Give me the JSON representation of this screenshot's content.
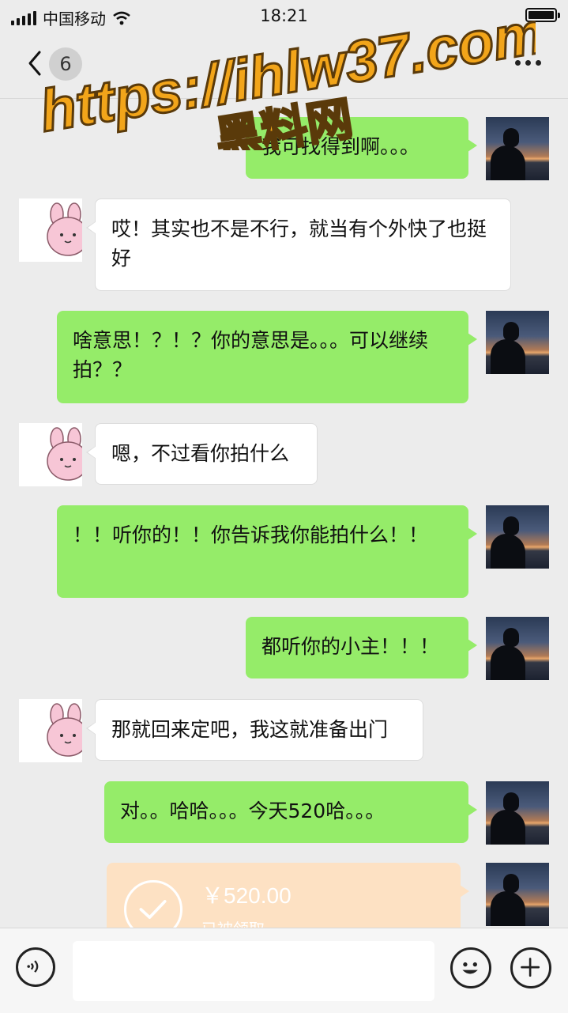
{
  "status_bar": {
    "carrier": "中国移动",
    "time": "18:21"
  },
  "nav": {
    "unread_count": "6",
    "title": ""
  },
  "watermark": {
    "url": "https://ihlw37.com",
    "site": "黑料网",
    "color": "#f2a51a"
  },
  "messages": [
    {
      "sender": "me",
      "text": "我可找得到啊。。。"
    },
    {
      "sender": "her",
      "text": "哎！其实也不是不行，就当有个外快了也挺好"
    },
    {
      "sender": "me",
      "text": "啥意思！？！？你的意思是。。。可以继续拍？？"
    },
    {
      "sender": "her",
      "text": "嗯，不过看你拍什么"
    },
    {
      "sender": "me",
      "text": "！！听你的！！你告诉我你能拍什么！！"
    },
    {
      "sender": "me",
      "text": "都听你的小主！！！"
    },
    {
      "sender": "her",
      "text": "那就回来定吧，我这就准备出门"
    },
    {
      "sender": "me",
      "text": "对。。哈哈。。。今天520哈。。。"
    }
  ],
  "transfer": {
    "amount": "￥520.00",
    "status": "已被领取"
  },
  "colors": {
    "my_bubble": "#95ec69",
    "her_bubble": "#ffffff",
    "transfer_card": "#fde1c3",
    "background": "#ececec"
  },
  "icons": [
    "signal-icon",
    "wifi-icon",
    "battery-icon",
    "back-icon",
    "more-icon",
    "voice-icon",
    "emoji-icon",
    "plus-icon",
    "check-icon"
  ]
}
